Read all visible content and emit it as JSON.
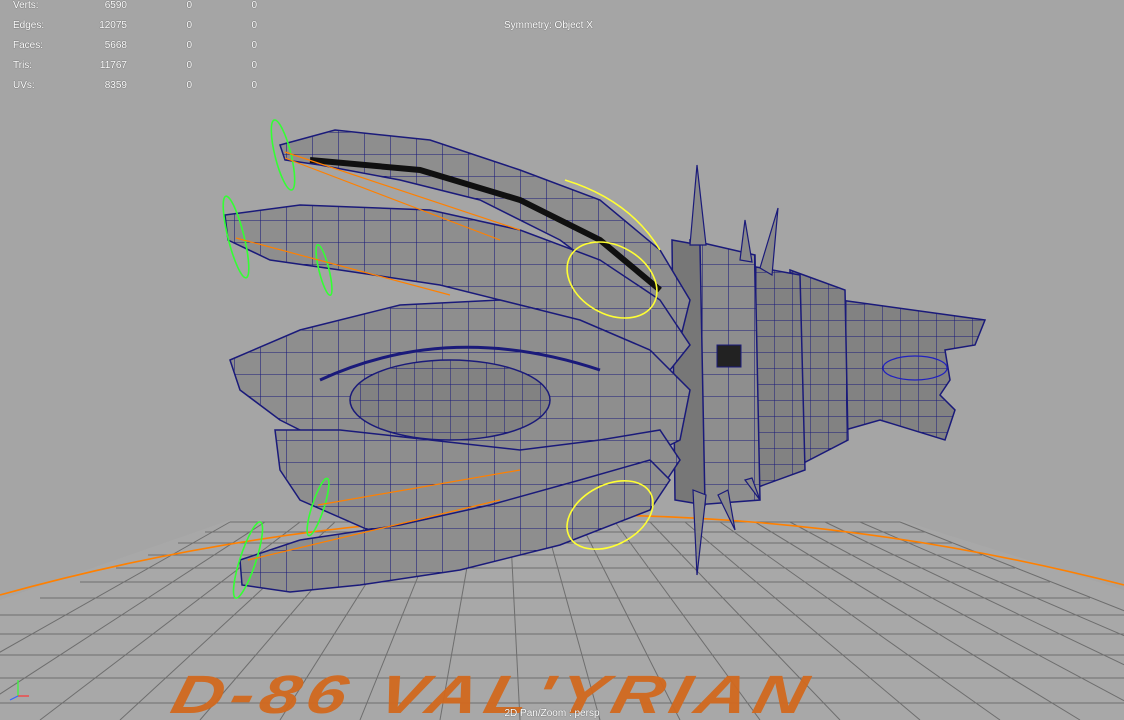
{
  "stats": {
    "rows": [
      {
        "label": "Verts:",
        "value": "6590",
        "sel1": "0",
        "sel2": "0"
      },
      {
        "label": "Edges:",
        "value": "12075",
        "sel1": "0",
        "sel2": "0"
      },
      {
        "label": "Faces:",
        "value": "5668",
        "sel1": "0",
        "sel2": "0"
      },
      {
        "label": "Tris:",
        "value": "11767",
        "sel1": "0",
        "sel2": "0"
      },
      {
        "label": "UVs:",
        "value": "8359",
        "sel1": "0",
        "sel2": "0"
      }
    ]
  },
  "viewport": {
    "symmetry": "Symmetry: Object X",
    "camera": "2D Pan/Zoom : persp",
    "floor_text": "D-86 VAL'YRIAN"
  },
  "colors": {
    "background": "#a5a5a5",
    "wireframe": "#1a1a7a",
    "mesh_fill": "#8c8c8c",
    "control_green": "#33ff33",
    "control_yellow": "#ffff33",
    "control_orange": "#ff8000",
    "grid": "#606060"
  },
  "icons": {
    "axis": "view-axis-icon"
  }
}
